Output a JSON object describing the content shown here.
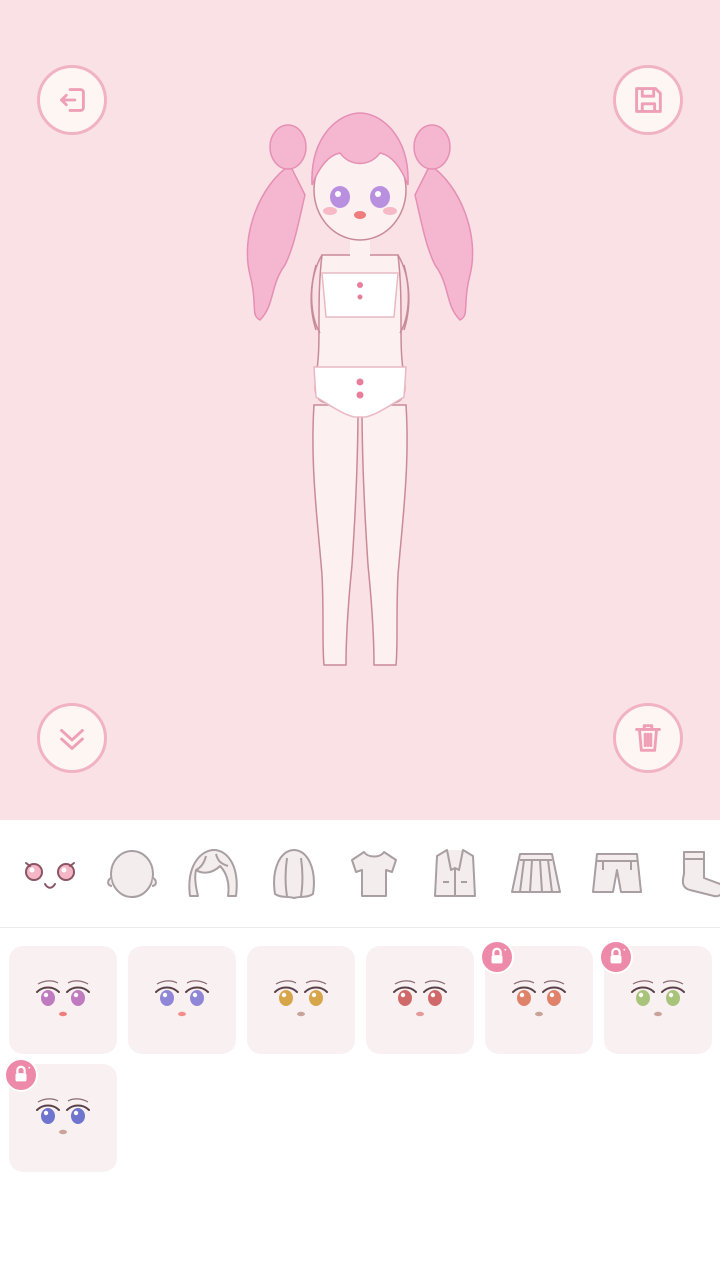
{
  "colors": {
    "stage_bg": "#f9e1e6",
    "button_ring": "#f1b2c4",
    "button_fill": "#fdf6f2",
    "icon_stroke": "#ef9fb7",
    "hair": "#f5b6cf",
    "skin": "#fdf0f0",
    "tile_bg": "#f8f0f1",
    "lock_badge": "#ee8aa9"
  },
  "toolbar": {
    "exit_icon": "exit-icon",
    "save_icon": "floppy-save-icon",
    "collapse_icon": "double-chevron-down-icon",
    "delete_icon": "trash-icon"
  },
  "categories": [
    {
      "name": "eyes",
      "icon": "eyes-icon",
      "selected": true
    },
    {
      "name": "head",
      "icon": "head-icon"
    },
    {
      "name": "hair-front",
      "icon": "hair-front-icon"
    },
    {
      "name": "hair-back",
      "icon": "hair-back-icon"
    },
    {
      "name": "shirt",
      "icon": "tshirt-icon"
    },
    {
      "name": "jacket",
      "icon": "jacket-icon"
    },
    {
      "name": "skirt",
      "icon": "skirt-icon"
    },
    {
      "name": "shorts",
      "icon": "shorts-icon"
    },
    {
      "name": "socks",
      "icon": "sock-icon"
    }
  ],
  "eye_options": [
    {
      "iris": "#c07ac0",
      "mouth": "#f07d7d",
      "locked": false
    },
    {
      "iris": "#8f86d8",
      "mouth": "#f58c8c",
      "locked": false
    },
    {
      "iris": "#d8a64a",
      "mouth": "#c9a39a",
      "locked": false
    },
    {
      "iris": "#d06a6a",
      "mouth": "#e59a9a",
      "locked": false
    },
    {
      "iris": "#e0826a",
      "mouth": "#c9a39a",
      "locked": true
    },
    {
      "iris": "#a8c47a",
      "mouth": "#c9a39a",
      "locked": true
    },
    {
      "iris": "#6f74cf",
      "mouth": "#c9a39a",
      "locked": true
    }
  ]
}
